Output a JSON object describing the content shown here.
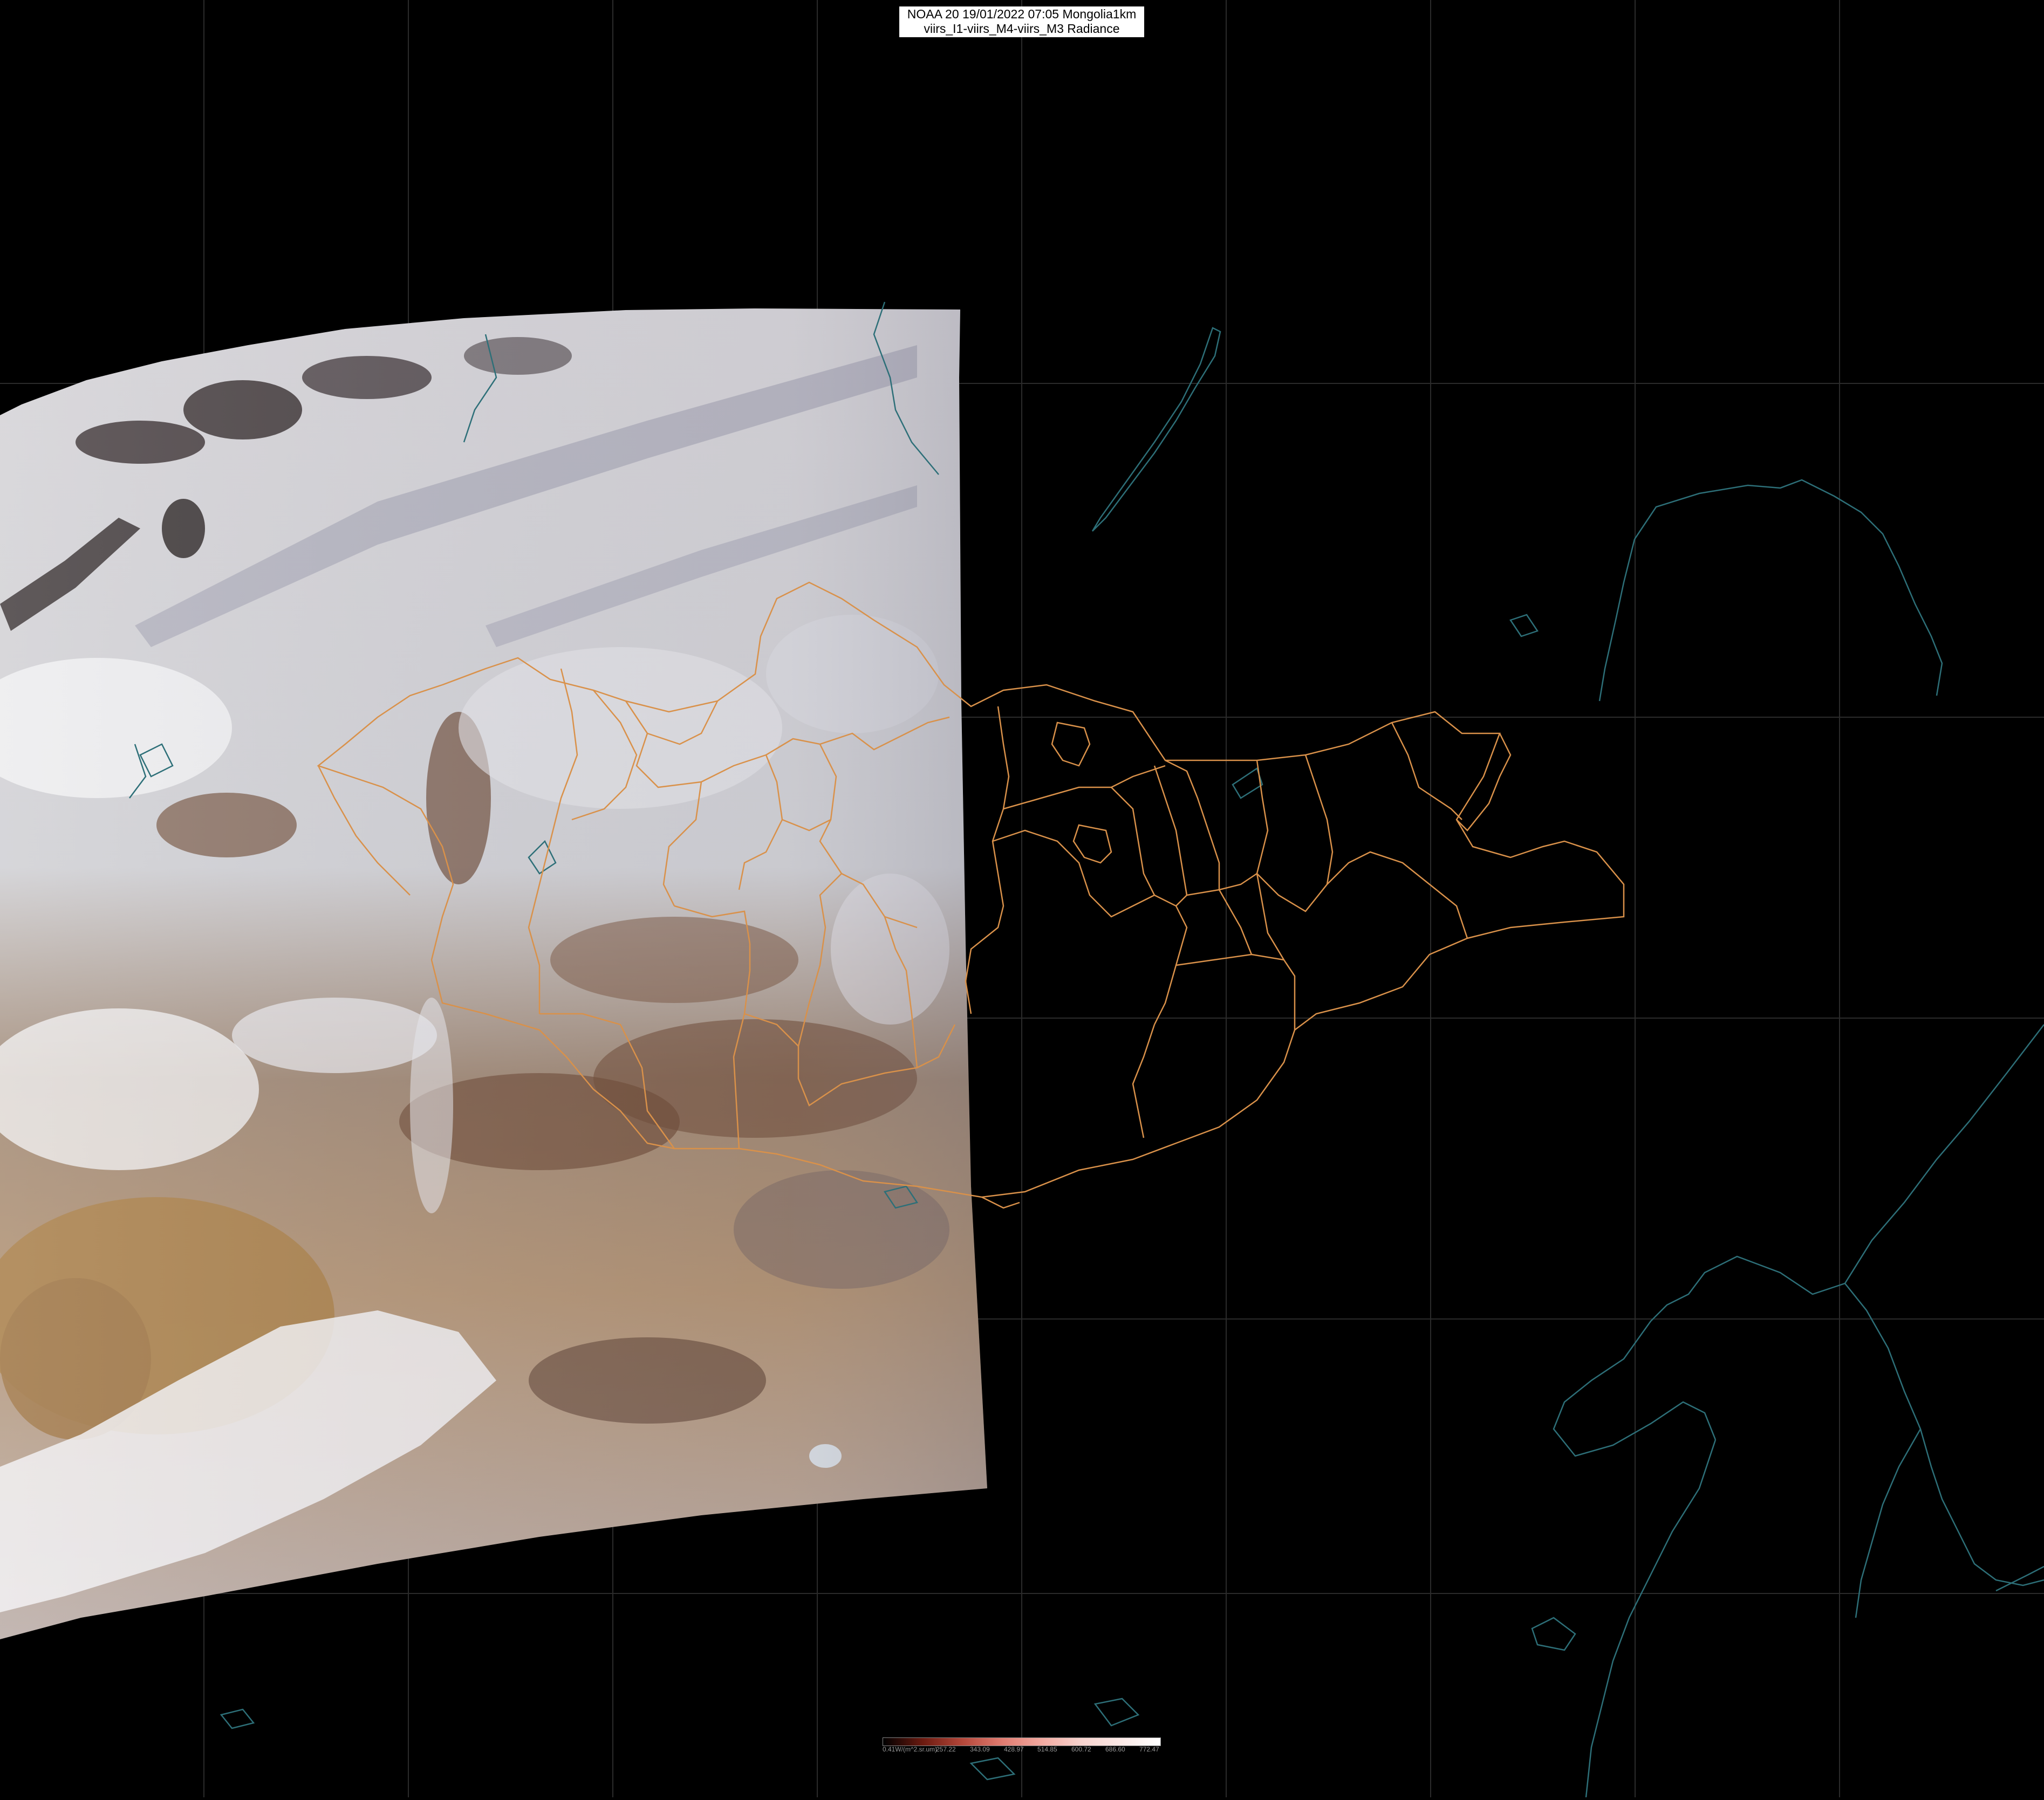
{
  "title": {
    "line1": "NOAA 20 19/01/2022 07:05 Mongolia1km",
    "line2": "viirs_I1-viirs_M4-viirs_M3 Radiance"
  },
  "colorbar": {
    "labels": [
      "0.41W/(m^2.sr.um)",
      "257.22",
      "343.09",
      "428.97",
      "514.85",
      "600.72",
      "686.60",
      "772.47"
    ],
    "colors": [
      "#000000",
      "#6b1a10",
      "#b4473a",
      "#e07b70",
      "#f2a9a0",
      "#f7d3ce",
      "#fbe9e6",
      "#ffffff"
    ]
  },
  "colors": {
    "background": "#000000",
    "graticule": "#2b2b2b",
    "coastline": "#2d6f78",
    "borders": "#d9914a"
  }
}
